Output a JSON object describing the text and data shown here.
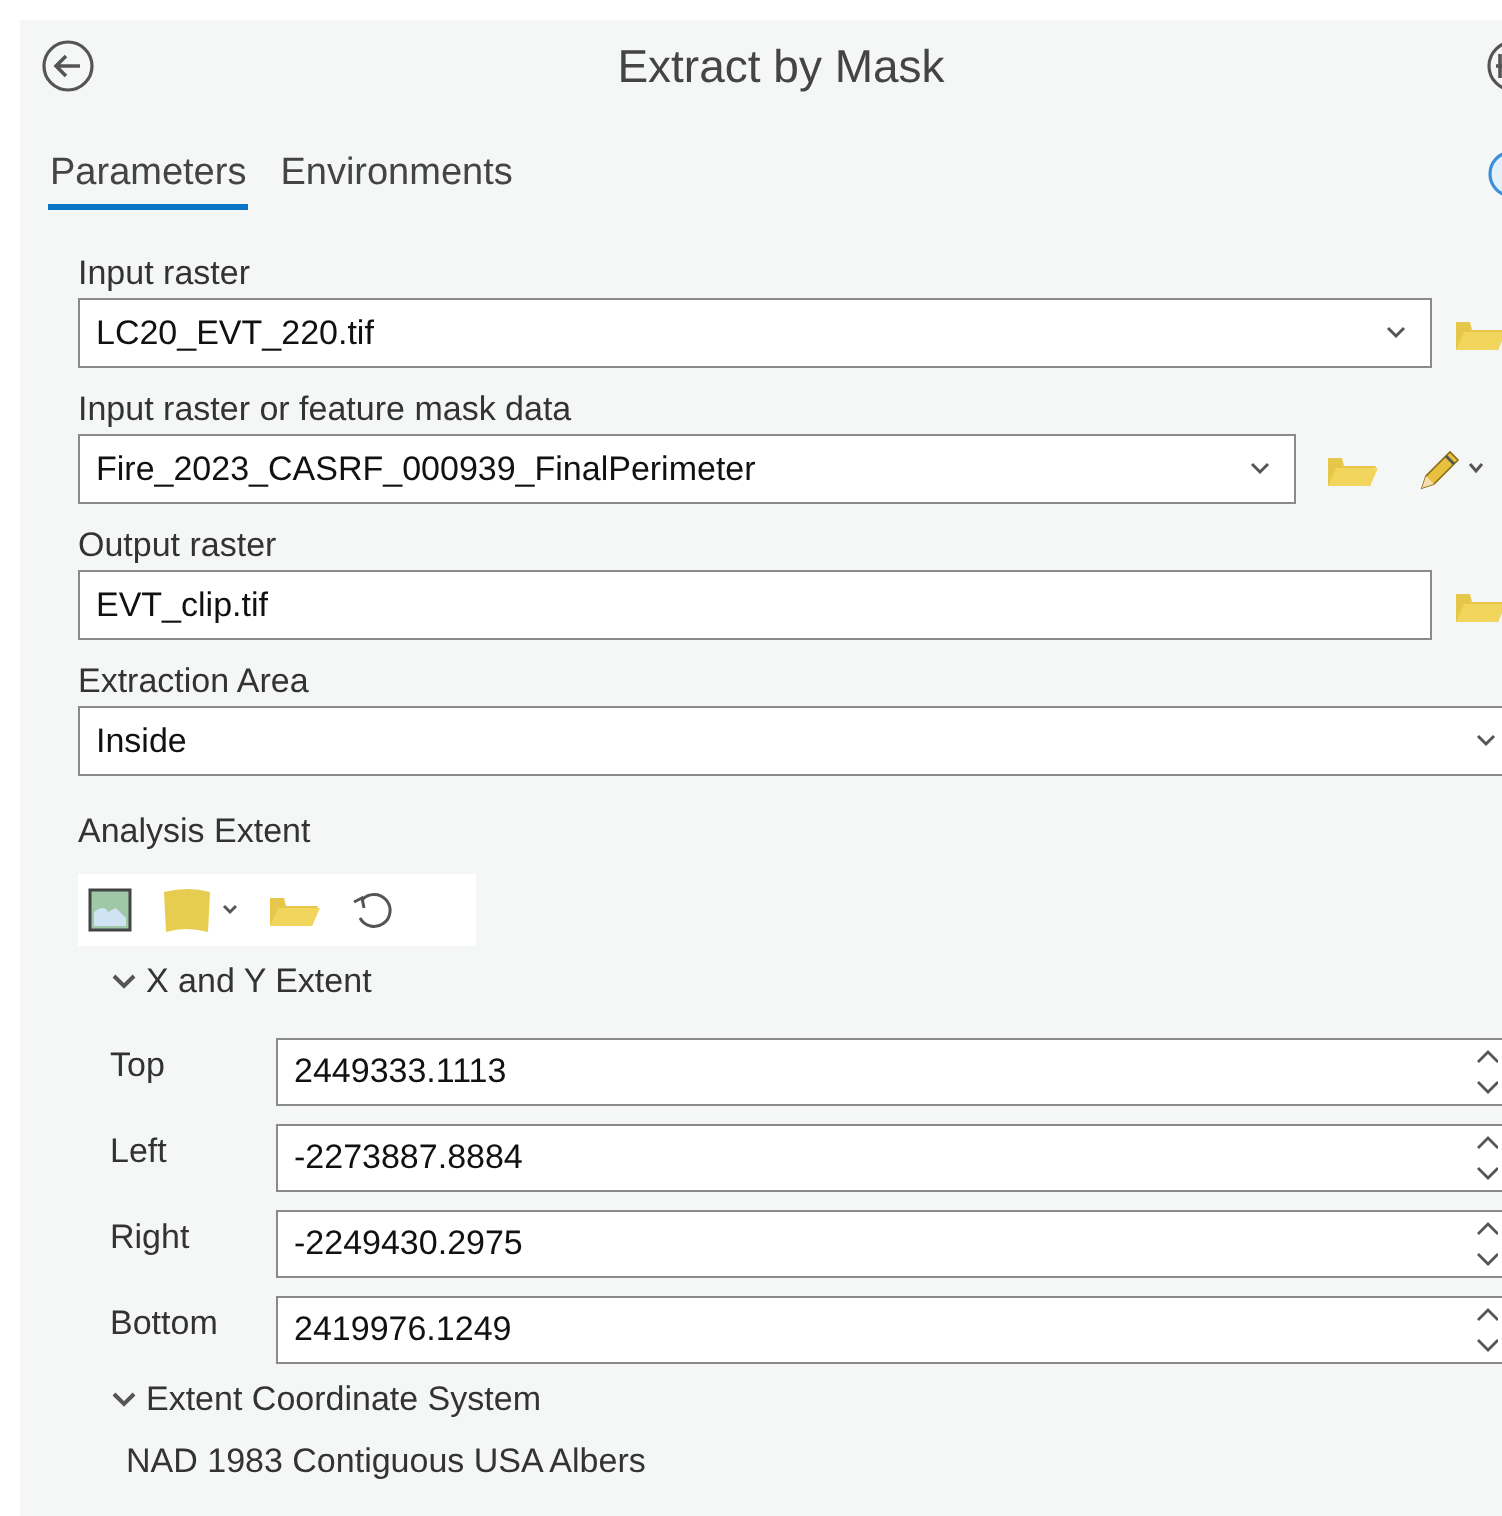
{
  "header": {
    "title": "Extract by Mask"
  },
  "tabs": [
    {
      "label": "Parameters",
      "selected": true
    },
    {
      "label": "Environments",
      "selected": false
    }
  ],
  "parameters": [
    {
      "kind": "dropdown_browse",
      "label": "Input raster",
      "value": "LC20_EVT_220.tif"
    },
    {
      "kind": "dropdown_browse_draw",
      "label": "Input raster or feature mask data",
      "value": "Fire_2023_CASRF_000939_FinalPerimeter"
    },
    {
      "kind": "text_browse",
      "label": "Output raster",
      "value": "EVT_clip.tif"
    },
    {
      "kind": "dropdown",
      "label": "Extraction Area",
      "value": "Inside"
    }
  ],
  "analysis_extent": {
    "label": "Analysis Extent",
    "xy_extent": {
      "title": "X and Y Extent",
      "expanded": true,
      "rows": [
        {
          "label": "Top",
          "value": "2449333.1113"
        },
        {
          "label": "Left",
          "value": "-2273887.8884"
        },
        {
          "label": "Right",
          "value": "-2249430.2975"
        },
        {
          "label": "Bottom",
          "value": "2419976.1249"
        }
      ]
    },
    "coordinate_system": {
      "title": "Extent Coordinate System",
      "expanded": true,
      "value": "NAD 1983 Contiguous USA Albers"
    }
  }
}
